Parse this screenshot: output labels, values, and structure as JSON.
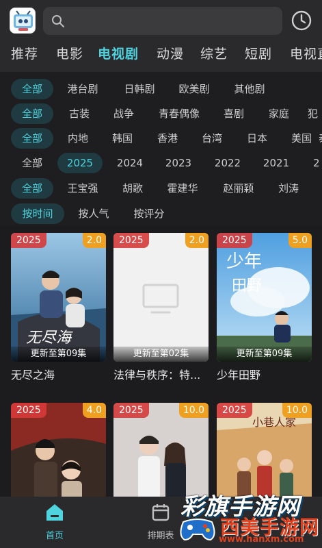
{
  "tabs": [
    "推荐",
    "电影",
    "电视剧",
    "动漫",
    "综艺",
    "短剧",
    "电视直"
  ],
  "active_tab": 2,
  "filters": {
    "region": [
      "全部",
      "港台剧",
      "日韩剧",
      "欧美剧",
      "其他剧"
    ],
    "genre": [
      "全部",
      "古装",
      "战争",
      "青春偶像",
      "喜剧",
      "家庭",
      "犯"
    ],
    "area": [
      "全部",
      "内地",
      "韩国",
      "香港",
      "台湾",
      "日本",
      "美国",
      "泰"
    ],
    "year": [
      "全部",
      "2025",
      "2024",
      "2023",
      "2022",
      "2021",
      "2"
    ],
    "actor": [
      "全部",
      "王宝强",
      "胡歌",
      "霍建华",
      "赵丽颖",
      "刘涛"
    ],
    "sort": [
      "按时间",
      "按人气",
      "按评分"
    ]
  },
  "cards": [
    {
      "year": "2025",
      "score": "2.0",
      "update": "更新至第09集",
      "title": "无尽之海"
    },
    {
      "year": "2025",
      "score": "2.0",
      "update": "更新至第02集",
      "title": "法律与秩序：特..."
    },
    {
      "year": "2025",
      "score": "5.0",
      "update": "更新至第09集",
      "title": "少年田野"
    },
    {
      "year": "2025",
      "score": "4.0",
      "update": "",
      "title": ""
    },
    {
      "year": "2025",
      "score": "10.0",
      "update": "",
      "title": ""
    },
    {
      "year": "2025",
      "score": "10.0",
      "update": "",
      "title": ""
    }
  ],
  "bottom_nav": {
    "home": "首页",
    "schedule": "排期表"
  },
  "watermark": {
    "line1": "彩旗手游网",
    "line2": "西美手游网",
    "line3": "www.hanxm.com"
  },
  "colors": {
    "accent": "#4fd3df",
    "year_badge": "#d63a3a",
    "score_badge": "#f0a020"
  }
}
